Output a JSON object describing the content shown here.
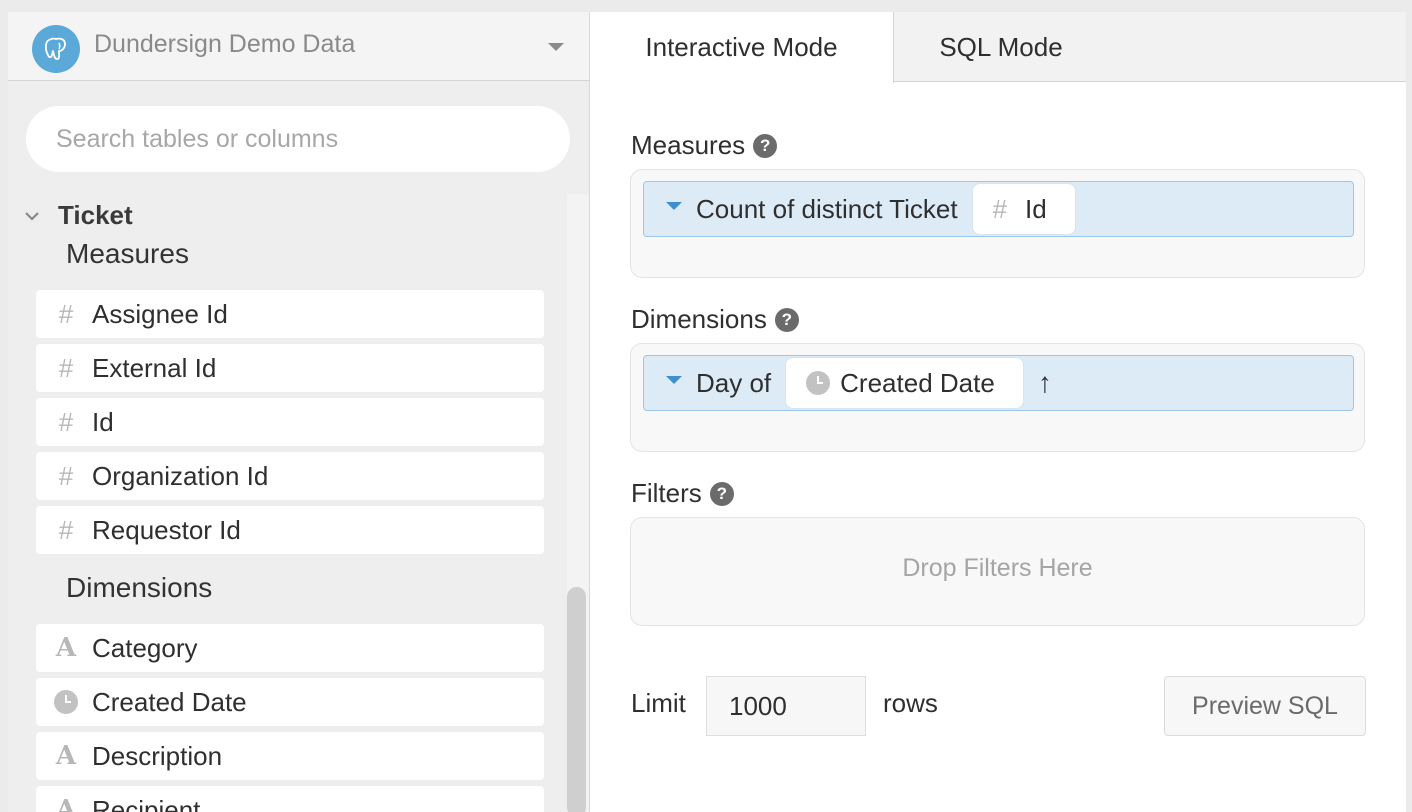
{
  "datasource": {
    "name": "Dundersign Demo Data",
    "logo_icon": "postgres-elephant-icon",
    "logo_color": "#5aa9d8"
  },
  "search": {
    "placeholder": "Search tables or columns",
    "value": ""
  },
  "table": {
    "name": "Ticket",
    "measures_label": "Measures",
    "measures": [
      {
        "label": "Assignee Id",
        "icon": "hash-icon"
      },
      {
        "label": "External Id",
        "icon": "hash-icon"
      },
      {
        "label": "Id",
        "icon": "hash-icon"
      },
      {
        "label": "Organization Id",
        "icon": "hash-icon"
      },
      {
        "label": "Requestor Id",
        "icon": "hash-icon"
      }
    ],
    "dimensions_label": "Dimensions",
    "dimensions": [
      {
        "label": "Category",
        "icon": "text-icon"
      },
      {
        "label": "Created Date",
        "icon": "clock-icon"
      },
      {
        "label": "Description",
        "icon": "text-icon"
      },
      {
        "label": "Recipient",
        "icon": "text-icon"
      }
    ]
  },
  "tabs": {
    "interactive": "Interactive Mode",
    "sql": "SQL Mode",
    "active": "interactive"
  },
  "builder": {
    "measures_title": "Measures",
    "measure_pill": {
      "prefix": "Count of distinct Ticket",
      "field": "Id",
      "field_icon": "hash-icon"
    },
    "dimensions_title": "Dimensions",
    "dimension_pill": {
      "prefix": "Day of",
      "field": "Created Date",
      "field_icon": "clock-icon",
      "sort_icon": "↑"
    },
    "filters_title": "Filters",
    "filters_placeholder": "Drop Filters Here",
    "limit_label": "Limit",
    "limit_value": "1000",
    "rows_label": "rows",
    "preview_button": "Preview SQL",
    "help_glyph": "?",
    "hash_glyph": "#",
    "text_glyph": "A"
  },
  "colors": {
    "accent": "#3d8fd0",
    "pill_background": "#ddebf7",
    "pill_border": "#9cc7e8"
  }
}
